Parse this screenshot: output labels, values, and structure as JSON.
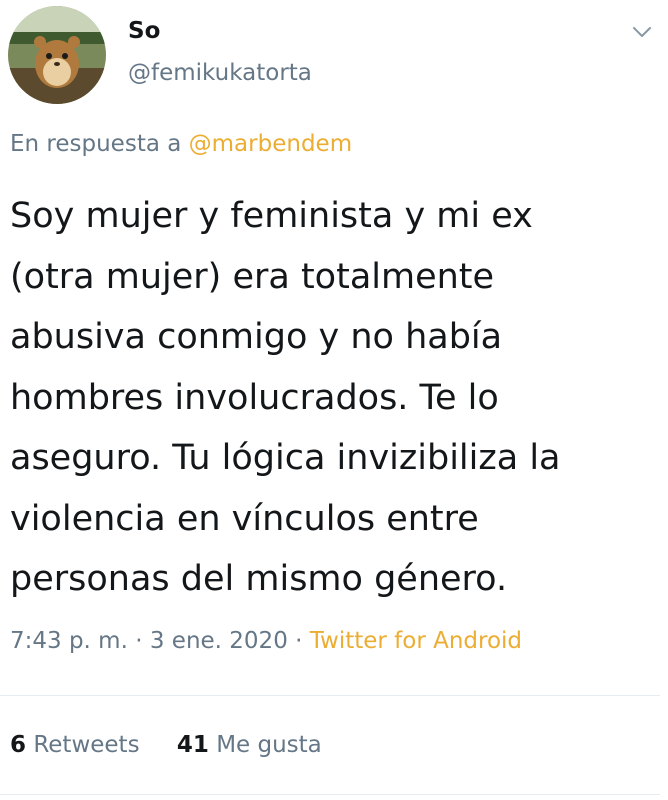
{
  "user": {
    "display_name": "So",
    "handle": "@femikukatorta",
    "avatar_icon": "hamster-avatar-icon"
  },
  "menu": {
    "icon": "chevron-down-icon"
  },
  "reply": {
    "prefix": "En respuesta a",
    "mention": "@marbendem"
  },
  "tweet": {
    "lines": [
      "Soy mujer y feminista y mi ex",
      "(otra mujer) era totalmente",
      "abusiva conmigo y no había",
      "hombres involucrados. Te lo",
      "aseguro. Tu lógica invizibiliza la",
      "violencia en vínculos entre",
      "personas del mismo género."
    ]
  },
  "meta": {
    "time": "7:43 p. m.",
    "separator1": "·",
    "date": "3 ene. 2020",
    "separator2": "·",
    "source": "Twitter for Android"
  },
  "stats": {
    "retweets_count": "6",
    "retweets_label": "Retweets",
    "likes_count": "41",
    "likes_label": "Me gusta"
  },
  "colors": {
    "link": "#ecad33",
    "secondary_text": "#657786",
    "primary_text": "#14171a",
    "divider": "#e6ecf0"
  }
}
